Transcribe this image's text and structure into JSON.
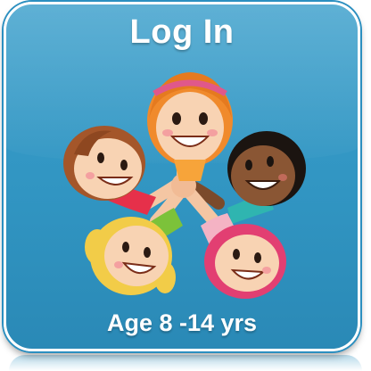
{
  "login_tile": {
    "title": "Log In",
    "subtitle": "Age 8 -14 yrs",
    "illustration_icon": "children-circle-illustration-icon"
  },
  "colors": {
    "tile_background": "#3195c2",
    "tile_border": "#ffffff",
    "text": "#ffffff"
  }
}
